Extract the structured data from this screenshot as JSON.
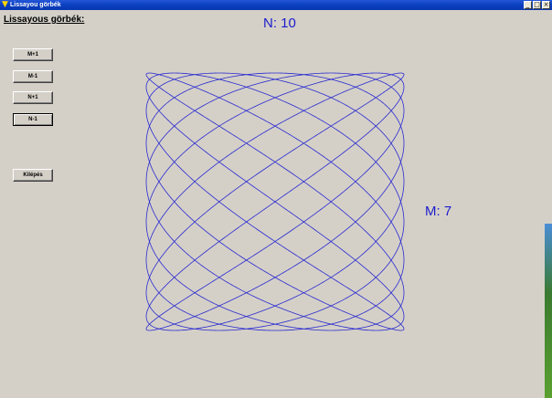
{
  "window": {
    "title": "Lissayou görbék",
    "controls": {
      "minimize": "_",
      "maximize": "□",
      "close": "×"
    }
  },
  "heading": "Lissayous görbék:",
  "buttons": {
    "m_plus": "M+1",
    "m_minus": "M-1",
    "n_plus": "N+1",
    "n_minus": "N-1",
    "exit": "Kilépés"
  },
  "labels": {
    "n_label": "N: 10",
    "m_label": "M: 7"
  },
  "curve": {
    "n": 10,
    "m": 7,
    "color": "#2a2ad0"
  }
}
